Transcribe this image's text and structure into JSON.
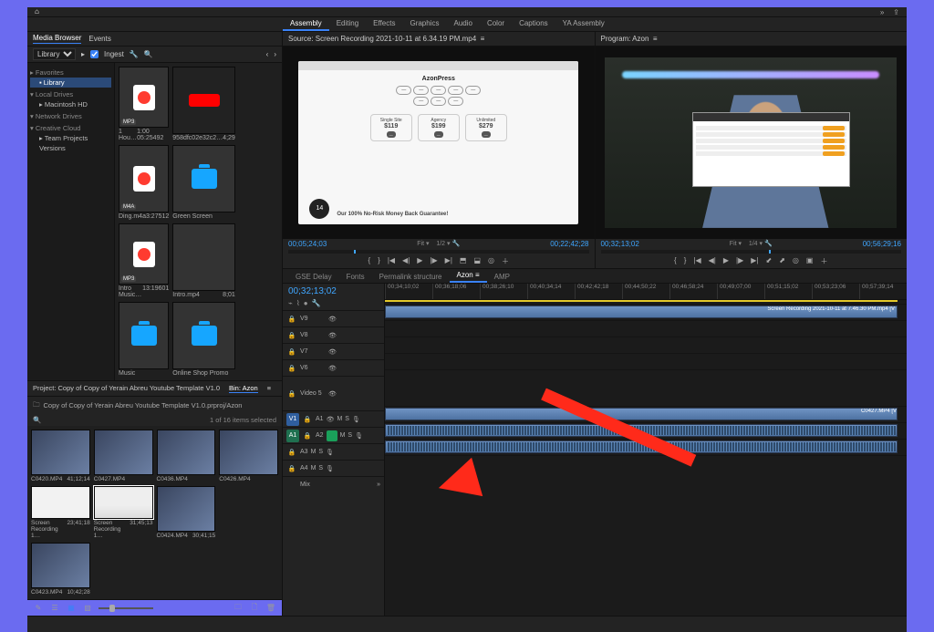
{
  "workspaces": [
    "Assembly",
    "Editing",
    "Effects",
    "Graphics",
    "Audio",
    "Color",
    "Captions",
    "YA Assembly"
  ],
  "active_workspace": 0,
  "media_browser": {
    "tab1": "Media Browser",
    "tab2": "Events",
    "library_label": "Library",
    "ingest": "Ingest",
    "tree": {
      "favorites": "Favorites",
      "library": "Library",
      "local": "Local Drives",
      "mac": "Macintosh HD",
      "network": "Network Drives",
      "cc": "Creative Cloud",
      "team": "Team Projects Versions"
    },
    "assets": [
      {
        "name": "1 Hou…",
        "dur": "1:00 05:25492",
        "type": "music",
        "tag": "MP3"
      },
      {
        "name": "958dfc02e32c2…",
        "dur": "4;29",
        "type": "yt"
      },
      {
        "name": "Ding.m4a",
        "dur": "3:27512",
        "type": "music",
        "tag": "M4A"
      },
      {
        "name": "Green Screen",
        "dur": "",
        "type": "folder"
      },
      {
        "name": "Intro Music…",
        "dur": "13:19601",
        "type": "music",
        "tag": "MP3"
      },
      {
        "name": "Intro.mp4",
        "dur": "8;01",
        "type": "video"
      },
      {
        "name": "Music",
        "dur": "",
        "type": "folder"
      },
      {
        "name": "Online Shop Promo",
        "dur": "",
        "type": "folder"
      }
    ]
  },
  "project": {
    "tab1": "Project: Copy of Copy of Yerain Abreu Youtube Template V1.0",
    "tab2": "Bin: Azon",
    "path": "Copy of Copy of Yerain Abreu Youtube Template V1.0.prproj/Azon",
    "selected": "1 of 16 items selected",
    "clips": [
      {
        "name": "C0420.MP4",
        "dur": "41;12;14"
      },
      {
        "name": "C0427.MP4",
        "dur": ""
      },
      {
        "name": "C0436.MP4",
        "dur": ""
      },
      {
        "name": "C0426.MP4",
        "dur": ""
      },
      {
        "name": "Screen Recording 1…",
        "dur": "23;41;18",
        "type": "doc"
      },
      {
        "name": "Screen Recording 1…",
        "dur": "31;45;13",
        "type": "ui",
        "sel": true
      },
      {
        "name": "C0424.MP4",
        "dur": "30;41;15"
      },
      {
        "name": "",
        "dur": ""
      },
      {
        "name": "C0423.MP4",
        "dur": "10;42;28"
      }
    ]
  },
  "source": {
    "title": "Source: Screen Recording 2021-10-11 at 6.34.19 PM.mp4",
    "tc_in": "00;05;24;03",
    "fit": "Fit",
    "zoom": "1/2",
    "tc_out": "00;22;42;28",
    "page_heading": "AzonPress",
    "plan1": {
      "name": "Single Site",
      "price": "$119"
    },
    "plan2": {
      "name": "Agency",
      "price": "$199"
    },
    "plan3": {
      "name": "Unlimited",
      "price": "$279"
    },
    "badge": "14",
    "guarantee": "Our 100% No-Risk Money Back Guarantee!"
  },
  "program": {
    "title": "Program: Azon",
    "tc_in": "00;32;13;02",
    "fit": "Fit",
    "zoom": "1/4",
    "tc_out": "00;56;29;16"
  },
  "timeline": {
    "tabs": [
      "GSE Delay",
      "Fonts",
      "Permalink structure",
      "Azon",
      "AMP"
    ],
    "active": 3,
    "tc": "00;32;13;02",
    "ruler": [
      "00;34;10;02",
      "00;36;18;06",
      "00;38;26;10",
      "00;40;34;14",
      "00;42;42;18",
      "00;44;50;22",
      "00;46;58;24",
      "00;49;07;00",
      "00;51;15;02",
      "00;53;23;06",
      "00;57;39;14"
    ],
    "v_tracks": [
      "V9",
      "V8",
      "V7",
      "V6",
      "Video 5"
    ],
    "v1": "V1",
    "a1": "A1",
    "mix": "Mix",
    "clip1": "Screen Recording 2021-10-11 at 7.46.30 PM.mp4 [V",
    "clip2": "C0427.MP4 [V"
  }
}
